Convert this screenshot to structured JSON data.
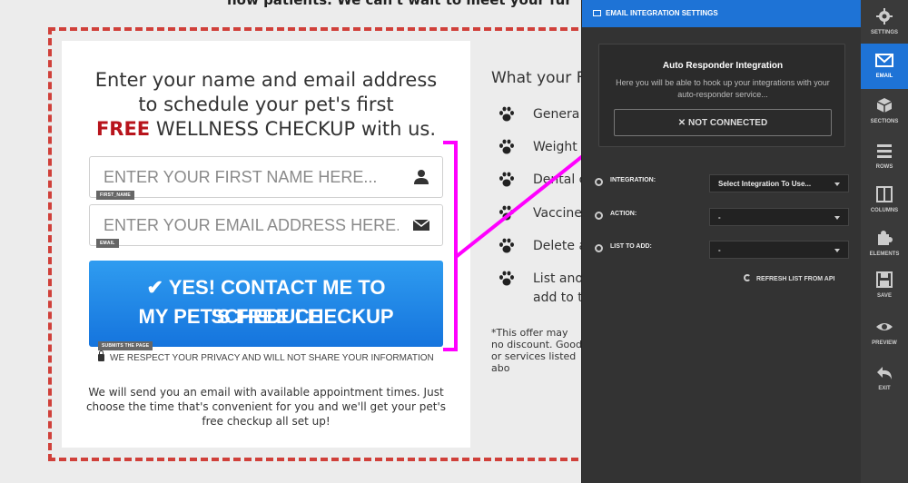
{
  "top_text": "now patients.  We can't wait to meet your fur",
  "form": {
    "headline_line1": "Enter your name and email address",
    "headline_line2": "to schedule your pet's first",
    "headline_free": "FREE",
    "headline_rest": " WELLNESS CHECKUP with us.",
    "first_name_placeholder": "ENTER YOUR FIRST NAME HERE...",
    "first_name_tag": "FIRST_NAME",
    "email_placeholder": "ENTER YOUR EMAIL ADDRESS HERE...",
    "email_tag": "EMAIL",
    "cta_line1": "YES! CONTACT ME TO SCHEDULE",
    "cta_line2": "MY PET'S FREE CHECKUP",
    "cta_tag": "SUBMITS THE PAGE",
    "privacy": "WE RESPECT YOUR PRIVACY AND WILL NOT SHARE YOUR INFORMATION",
    "bottom_text": "We will send you an email with available appointment times. Just choose the time that's convenient for you and we'll get your pet's free checkup all set up!"
  },
  "features": {
    "heading": "What your F",
    "items": [
      "Genera",
      "Weight",
      "Dental c",
      "Vaccine",
      "Delete a",
      "List ano",
      "add to t"
    ]
  },
  "offer_text": "*This offer may no discount.  Good or services listed abo",
  "panel": {
    "title": "EMAIL INTEGRATION SETTINGS",
    "ar_title": "Auto Responder Integration",
    "ar_desc": "Here you will be able to hook up your integrations with your auto-responder service...",
    "status_button": "NOT CONNECTED",
    "rows": [
      {
        "label": "INTEGRATION:",
        "value": "Select Integration To Use..."
      },
      {
        "label": "ACTION:",
        "value": "-"
      },
      {
        "label": "LIST TO ADD:",
        "value": "-"
      }
    ],
    "refresh": "REFRESH LIST FROM API"
  },
  "rail": [
    {
      "label": "SETTINGS",
      "icon": "gear-icon"
    },
    {
      "label": "EMAIL",
      "icon": "envelope-icon",
      "active": true
    },
    {
      "label": "SECTIONS",
      "icon": "cube-icon"
    },
    {
      "label": "ROWS",
      "icon": "rows-icon"
    },
    {
      "label": "COLUMNS",
      "icon": "columns-icon"
    },
    {
      "label": "ELEMENTS",
      "icon": "puzzle-icon"
    },
    {
      "label": "SAVE",
      "icon": "floppy-icon"
    },
    {
      "label": "PREVIEW",
      "icon": "eye-icon"
    },
    {
      "label": "EXIT",
      "icon": "exit-icon"
    }
  ],
  "colors": {
    "accent_blue": "#1e73d6",
    "free_red": "#b8141c",
    "annotation_magenta": "#ff00ff",
    "dashed_border": "#d0403a"
  }
}
